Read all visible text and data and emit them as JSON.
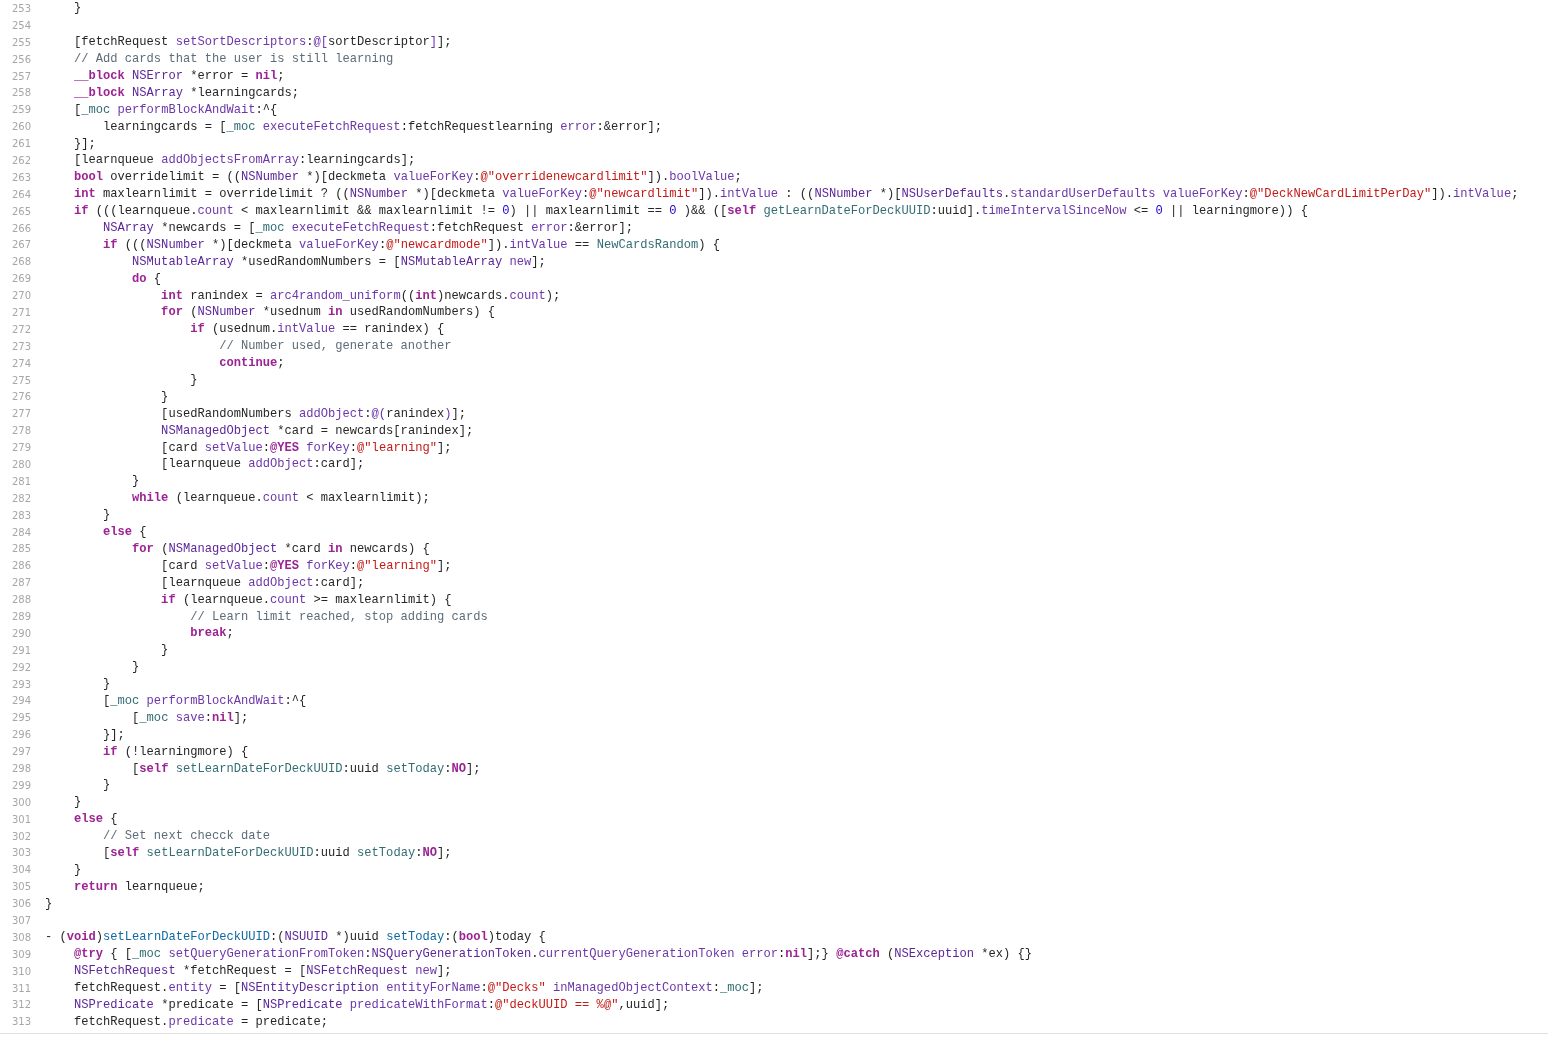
{
  "editor": {
    "lines": [
      {
        "number": "253",
        "tokens": [
          {
            "kind": "plain",
            "text": "    }"
          }
        ]
      },
      {
        "number": "254"
      },
      {
        "number": "255",
        "tokens": [
          {
            "kind": "plain",
            "text": "    [fetchRequest "
          },
          {
            "kind": "method",
            "text": "setSortDescriptors"
          },
          {
            "kind": "plain",
            "text": ":"
          },
          {
            "kind": "method",
            "text": "@["
          },
          {
            "kind": "plain",
            "text": "sortDescriptor"
          },
          {
            "kind": "method",
            "text": "]"
          },
          {
            "kind": "plain",
            "text": "];"
          }
        ]
      },
      {
        "number": "256",
        "tokens": [
          {
            "kind": "comment",
            "text": "    // Add cards that the user is still learning"
          }
        ]
      },
      {
        "number": "257",
        "tokens": [
          {
            "kind": "keyword",
            "text": "    __block"
          },
          {
            "kind": "type",
            "text": " NSError"
          },
          {
            "kind": "plain",
            "text": " *error = "
          },
          {
            "kind": "keyword",
            "text": "nil"
          },
          {
            "kind": "plain",
            "text": ";"
          }
        ]
      },
      {
        "number": "258",
        "tokens": [
          {
            "kind": "keyword",
            "text": "    __block"
          },
          {
            "kind": "type",
            "text": " NSArray"
          },
          {
            "kind": "plain",
            "text": " *learningcards;"
          }
        ]
      },
      {
        "number": "259",
        "tokens": [
          {
            "kind": "plain",
            "text": "    ["
          },
          {
            "kind": "project",
            "text": "_moc"
          },
          {
            "kind": "method",
            "text": " performBlockAndWait"
          },
          {
            "kind": "plain",
            "text": ":^{"
          }
        ]
      },
      {
        "number": "260",
        "tokens": [
          {
            "kind": "plain",
            "text": "        learningcards = ["
          },
          {
            "kind": "project",
            "text": "_moc"
          },
          {
            "kind": "method",
            "text": " executeFetchRequest"
          },
          {
            "kind": "plain",
            "text": ":fetchRequestlearning "
          },
          {
            "kind": "method",
            "text": "error"
          },
          {
            "kind": "plain",
            "text": ":&error];"
          }
        ]
      },
      {
        "number": "261",
        "tokens": [
          {
            "kind": "plain",
            "text": "    }];"
          }
        ]
      },
      {
        "number": "262",
        "tokens": [
          {
            "kind": "plain",
            "text": "    [learnqueue "
          },
          {
            "kind": "method",
            "text": "addObjectsFromArray"
          },
          {
            "kind": "plain",
            "text": ":learningcards];"
          }
        ]
      },
      {
        "number": "263",
        "tokens": [
          {
            "kind": "keyword",
            "text": "    bool"
          },
          {
            "kind": "plain",
            "text": " overridelimit = (("
          },
          {
            "kind": "type",
            "text": "NSNumber"
          },
          {
            "kind": "plain",
            "text": " *)[deckmeta "
          },
          {
            "kind": "method",
            "text": "valueForKey"
          },
          {
            "kind": "plain",
            "text": ":"
          },
          {
            "kind": "string",
            "text": "@\"overridenewcardlimit\""
          },
          {
            "kind": "plain",
            "text": "])."
          },
          {
            "kind": "method",
            "text": "boolValue"
          },
          {
            "kind": "plain",
            "text": ";"
          }
        ]
      },
      {
        "number": "264",
        "tokens": [
          {
            "kind": "keyword",
            "text": "    int"
          },
          {
            "kind": "plain",
            "text": " maxlearnlimit = overridelimit ? (("
          },
          {
            "kind": "type",
            "text": "NSNumber"
          },
          {
            "kind": "plain",
            "text": " *)[deckmeta "
          },
          {
            "kind": "method",
            "text": "valueForKey"
          },
          {
            "kind": "plain",
            "text": ":"
          },
          {
            "kind": "string",
            "text": "@\"newcardlimit\""
          },
          {
            "kind": "plain",
            "text": "])."
          },
          {
            "kind": "method",
            "text": "intValue"
          },
          {
            "kind": "plain",
            "text": " : (("
          },
          {
            "kind": "type",
            "text": "NSNumber"
          },
          {
            "kind": "plain",
            "text": " *)["
          },
          {
            "kind": "type",
            "text": "NSUserDefaults"
          },
          {
            "kind": "plain",
            "text": "."
          },
          {
            "kind": "method",
            "text": "standardUserDefaults valueForKey"
          },
          {
            "kind": "plain",
            "text": ":"
          },
          {
            "kind": "string",
            "text": "@\"DeckNewCardLimitPerDay\""
          },
          {
            "kind": "plain",
            "text": "])."
          },
          {
            "kind": "method",
            "text": "intValue"
          },
          {
            "kind": "plain",
            "text": ";"
          }
        ]
      },
      {
        "number": "265",
        "tokens": [
          {
            "kind": "keyword",
            "text": "    if"
          },
          {
            "kind": "plain",
            "text": " (((learnqueue."
          },
          {
            "kind": "method",
            "text": "count"
          },
          {
            "kind": "plain",
            "text": " < maxlearnlimit && maxlearnlimit != "
          },
          {
            "kind": "number",
            "text": "0"
          },
          {
            "kind": "plain",
            "text": ") || maxlearnlimit == "
          },
          {
            "kind": "number",
            "text": "0"
          },
          {
            "kind": "plain",
            "text": " )&& (["
          },
          {
            "kind": "keyword",
            "text": "self"
          },
          {
            "kind": "project",
            "text": " getLearnDateForDeckUUID"
          },
          {
            "kind": "plain",
            "text": ":uuid]."
          },
          {
            "kind": "method",
            "text": "timeIntervalSinceNow"
          },
          {
            "kind": "plain",
            "text": " <= "
          },
          {
            "kind": "number",
            "text": "0"
          },
          {
            "kind": "plain",
            "text": " || learningmore)) {"
          }
        ]
      },
      {
        "number": "266",
        "tokens": [
          {
            "kind": "type",
            "text": "        NSArray"
          },
          {
            "kind": "plain",
            "text": " *newcards = ["
          },
          {
            "kind": "project",
            "text": "_moc"
          },
          {
            "kind": "method",
            "text": " executeFetchRequest"
          },
          {
            "kind": "plain",
            "text": ":fetchRequest "
          },
          {
            "kind": "method",
            "text": "error"
          },
          {
            "kind": "plain",
            "text": ":&error];"
          }
        ]
      },
      {
        "number": "267",
        "tokens": [
          {
            "kind": "keyword",
            "text": "        if"
          },
          {
            "kind": "plain",
            "text": " ((("
          },
          {
            "kind": "type",
            "text": "NSNumber"
          },
          {
            "kind": "plain",
            "text": " *)[deckmeta "
          },
          {
            "kind": "method",
            "text": "valueForKey"
          },
          {
            "kind": "plain",
            "text": ":"
          },
          {
            "kind": "string",
            "text": "@\"newcardmode\""
          },
          {
            "kind": "plain",
            "text": "])."
          },
          {
            "kind": "method",
            "text": "intValue"
          },
          {
            "kind": "plain",
            "text": " == "
          },
          {
            "kind": "project",
            "text": "NewCardsRandom"
          },
          {
            "kind": "plain",
            "text": ") {"
          }
        ]
      },
      {
        "number": "268",
        "tokens": [
          {
            "kind": "type",
            "text": "            NSMutableArray"
          },
          {
            "kind": "plain",
            "text": " *usedRandomNumbers = ["
          },
          {
            "kind": "type",
            "text": "NSMutableArray"
          },
          {
            "kind": "method",
            "text": " new"
          },
          {
            "kind": "plain",
            "text": "];"
          }
        ]
      },
      {
        "number": "269",
        "tokens": [
          {
            "kind": "keyword",
            "text": "            do"
          },
          {
            "kind": "plain",
            "text": " {"
          }
        ]
      },
      {
        "number": "270",
        "tokens": [
          {
            "kind": "keyword",
            "text": "                int"
          },
          {
            "kind": "plain",
            "text": " ranindex = "
          },
          {
            "kind": "method",
            "text": "arc4random_uniform"
          },
          {
            "kind": "plain",
            "text": "(("
          },
          {
            "kind": "keyword",
            "text": "int"
          },
          {
            "kind": "plain",
            "text": ")newcards."
          },
          {
            "kind": "method",
            "text": "count"
          },
          {
            "kind": "plain",
            "text": ");"
          }
        ]
      },
      {
        "number": "271",
        "tokens": [
          {
            "kind": "keyword",
            "text": "                for"
          },
          {
            "kind": "plain",
            "text": " ("
          },
          {
            "kind": "type",
            "text": "NSNumber"
          },
          {
            "kind": "plain",
            "text": " *usednum "
          },
          {
            "kind": "keyword",
            "text": "in"
          },
          {
            "kind": "plain",
            "text": " usedRandomNumbers) {"
          }
        ]
      },
      {
        "number": "272",
        "tokens": [
          {
            "kind": "keyword",
            "text": "                    if"
          },
          {
            "kind": "plain",
            "text": " (usednum."
          },
          {
            "kind": "method",
            "text": "intValue"
          },
          {
            "kind": "plain",
            "text": " == ranindex) {"
          }
        ]
      },
      {
        "number": "273",
        "tokens": [
          {
            "kind": "comment",
            "text": "                        // Number used, generate another"
          }
        ]
      },
      {
        "number": "274",
        "tokens": [
          {
            "kind": "keyword",
            "text": "                        continue"
          },
          {
            "kind": "plain",
            "text": ";"
          }
        ]
      },
      {
        "number": "275",
        "tokens": [
          {
            "kind": "plain",
            "text": "                    }"
          }
        ]
      },
      {
        "number": "276",
        "tokens": [
          {
            "kind": "plain",
            "text": "                }"
          }
        ]
      },
      {
        "number": "277",
        "tokens": [
          {
            "kind": "plain",
            "text": "                [usedRandomNumbers "
          },
          {
            "kind": "method",
            "text": "addObject"
          },
          {
            "kind": "plain",
            "text": ":"
          },
          {
            "kind": "method",
            "text": "@("
          },
          {
            "kind": "plain",
            "text": "ranindex"
          },
          {
            "kind": "method",
            "text": ")"
          },
          {
            "kind": "plain",
            "text": "];"
          }
        ]
      },
      {
        "number": "278",
        "tokens": [
          {
            "kind": "type",
            "text": "                NSManagedObject"
          },
          {
            "kind": "plain",
            "text": " *card = newcards[ranindex];"
          }
        ]
      },
      {
        "number": "279",
        "tokens": [
          {
            "kind": "plain",
            "text": "                [card "
          },
          {
            "kind": "method",
            "text": "setValue"
          },
          {
            "kind": "plain",
            "text": ":"
          },
          {
            "kind": "keyword",
            "text": "@YES"
          },
          {
            "kind": "method",
            "text": " forKey"
          },
          {
            "kind": "plain",
            "text": ":"
          },
          {
            "kind": "string",
            "text": "@\"learning\""
          },
          {
            "kind": "plain",
            "text": "];"
          }
        ]
      },
      {
        "number": "280",
        "tokens": [
          {
            "kind": "plain",
            "text": "                [learnqueue "
          },
          {
            "kind": "method",
            "text": "addObject"
          },
          {
            "kind": "plain",
            "text": ":card];"
          }
        ]
      },
      {
        "number": "281",
        "tokens": [
          {
            "kind": "plain",
            "text": "            }"
          }
        ]
      },
      {
        "number": "282",
        "tokens": [
          {
            "kind": "keyword",
            "text": "            while"
          },
          {
            "kind": "plain",
            "text": " (learnqueue."
          },
          {
            "kind": "method",
            "text": "count"
          },
          {
            "kind": "plain",
            "text": " < maxlearnlimit);"
          }
        ]
      },
      {
        "number": "283",
        "tokens": [
          {
            "kind": "plain",
            "text": "        }"
          }
        ]
      },
      {
        "number": "284",
        "tokens": [
          {
            "kind": "keyword",
            "text": "        else"
          },
          {
            "kind": "plain",
            "text": " {"
          }
        ]
      },
      {
        "number": "285",
        "tokens": [
          {
            "kind": "keyword",
            "text": "            for"
          },
          {
            "kind": "plain",
            "text": " ("
          },
          {
            "kind": "type",
            "text": "NSManagedObject"
          },
          {
            "kind": "plain",
            "text": " *card "
          },
          {
            "kind": "keyword",
            "text": "in"
          },
          {
            "kind": "plain",
            "text": " newcards) {"
          }
        ]
      },
      {
        "number": "286",
        "tokens": [
          {
            "kind": "plain",
            "text": "                [card "
          },
          {
            "kind": "method",
            "text": "setValue"
          },
          {
            "kind": "plain",
            "text": ":"
          },
          {
            "kind": "keyword",
            "text": "@YES"
          },
          {
            "kind": "method",
            "text": " forKey"
          },
          {
            "kind": "plain",
            "text": ":"
          },
          {
            "kind": "string",
            "text": "@\"learning\""
          },
          {
            "kind": "plain",
            "text": "];"
          }
        ]
      },
      {
        "number": "287",
        "tokens": [
          {
            "kind": "plain",
            "text": "                [learnqueue "
          },
          {
            "kind": "method",
            "text": "addObject"
          },
          {
            "kind": "plain",
            "text": ":card];"
          }
        ]
      },
      {
        "number": "288",
        "tokens": [
          {
            "kind": "keyword",
            "text": "                if"
          },
          {
            "kind": "plain",
            "text": " (learnqueue."
          },
          {
            "kind": "method",
            "text": "count"
          },
          {
            "kind": "plain",
            "text": " >= maxlearnlimit) {"
          }
        ]
      },
      {
        "number": "289",
        "tokens": [
          {
            "kind": "comment",
            "text": "                    // Learn limit reached, stop adding cards"
          }
        ]
      },
      {
        "number": "290",
        "tokens": [
          {
            "kind": "keyword",
            "text": "                    break"
          },
          {
            "kind": "plain",
            "text": ";"
          }
        ]
      },
      {
        "number": "291",
        "tokens": [
          {
            "kind": "plain",
            "text": "                }"
          }
        ]
      },
      {
        "number": "292",
        "tokens": [
          {
            "kind": "plain",
            "text": "            }"
          }
        ]
      },
      {
        "number": "293",
        "tokens": [
          {
            "kind": "plain",
            "text": "        }"
          }
        ]
      },
      {
        "number": "294",
        "tokens": [
          {
            "kind": "plain",
            "text": "        ["
          },
          {
            "kind": "project",
            "text": "_moc"
          },
          {
            "kind": "method",
            "text": " performBlockAndWait"
          },
          {
            "kind": "plain",
            "text": ":^{"
          }
        ]
      },
      {
        "number": "295",
        "tokens": [
          {
            "kind": "plain",
            "text": "            ["
          },
          {
            "kind": "project",
            "text": "_moc"
          },
          {
            "kind": "method",
            "text": " save"
          },
          {
            "kind": "plain",
            "text": ":"
          },
          {
            "kind": "keyword",
            "text": "nil"
          },
          {
            "kind": "plain",
            "text": "];"
          }
        ]
      },
      {
        "number": "296",
        "tokens": [
          {
            "kind": "plain",
            "text": "        }];"
          }
        ]
      },
      {
        "number": "297",
        "tokens": [
          {
            "kind": "keyword",
            "text": "        if"
          },
          {
            "kind": "plain",
            "text": " (!learningmore) {"
          }
        ]
      },
      {
        "number": "298",
        "tokens": [
          {
            "kind": "plain",
            "text": "            ["
          },
          {
            "kind": "keyword",
            "text": "self"
          },
          {
            "kind": "project",
            "text": " setLearnDateForDeckUUID"
          },
          {
            "kind": "plain",
            "text": ":uuid "
          },
          {
            "kind": "project",
            "text": "setToday"
          },
          {
            "kind": "plain",
            "text": ":"
          },
          {
            "kind": "keyword",
            "text": "NO"
          },
          {
            "kind": "plain",
            "text": "];"
          }
        ]
      },
      {
        "number": "299",
        "tokens": [
          {
            "kind": "plain",
            "text": "        }"
          }
        ]
      },
      {
        "number": "300",
        "tokens": [
          {
            "kind": "plain",
            "text": "    }"
          }
        ]
      },
      {
        "number": "301",
        "tokens": [
          {
            "kind": "keyword",
            "text": "    else"
          },
          {
            "kind": "plain",
            "text": " {"
          }
        ]
      },
      {
        "number": "302",
        "tokens": [
          {
            "kind": "comment",
            "text": "        // Set next checck date"
          }
        ]
      },
      {
        "number": "303",
        "tokens": [
          {
            "kind": "plain",
            "text": "        ["
          },
          {
            "kind": "keyword",
            "text": "self"
          },
          {
            "kind": "project",
            "text": " setLearnDateForDeckUUID"
          },
          {
            "kind": "plain",
            "text": ":uuid "
          },
          {
            "kind": "project",
            "text": "setToday"
          },
          {
            "kind": "plain",
            "text": ":"
          },
          {
            "kind": "keyword",
            "text": "NO"
          },
          {
            "kind": "plain",
            "text": "];"
          }
        ]
      },
      {
        "number": "304",
        "tokens": [
          {
            "kind": "plain",
            "text": "    }"
          }
        ]
      },
      {
        "number": "305",
        "tokens": [
          {
            "kind": "keyword",
            "text": "    return"
          },
          {
            "kind": "plain",
            "text": " learnqueue;"
          }
        ]
      },
      {
        "number": "306",
        "tokens": [
          {
            "kind": "plain",
            "text": "}"
          }
        ]
      },
      {
        "number": "307"
      },
      {
        "number": "308",
        "tokens": [
          {
            "kind": "plain",
            "text": "- ("
          },
          {
            "kind": "keyword",
            "text": "void"
          },
          {
            "kind": "plain",
            "text": ")"
          },
          {
            "kind": "decl",
            "text": "setLearnDateForDeckUUID"
          },
          {
            "kind": "plain",
            "text": ":("
          },
          {
            "kind": "type",
            "text": "NSUUID"
          },
          {
            "kind": "plain",
            "text": " *)uuid "
          },
          {
            "kind": "decl",
            "text": "setToday"
          },
          {
            "kind": "plain",
            "text": ":("
          },
          {
            "kind": "keyword",
            "text": "bool"
          },
          {
            "kind": "plain",
            "text": ")today {"
          }
        ]
      },
      {
        "number": "309",
        "tokens": [
          {
            "kind": "keyword",
            "text": "    @try"
          },
          {
            "kind": "plain",
            "text": " { ["
          },
          {
            "kind": "project",
            "text": "_moc"
          },
          {
            "kind": "method",
            "text": " setQueryGenerationFromToken"
          },
          {
            "kind": "plain",
            "text": ":"
          },
          {
            "kind": "type",
            "text": "NSQueryGenerationToken"
          },
          {
            "kind": "plain",
            "text": "."
          },
          {
            "kind": "method",
            "text": "currentQueryGenerationToken error"
          },
          {
            "kind": "plain",
            "text": ":"
          },
          {
            "kind": "keyword",
            "text": "nil"
          },
          {
            "kind": "plain",
            "text": "];} "
          },
          {
            "kind": "keyword",
            "text": "@catch"
          },
          {
            "kind": "plain",
            "text": " ("
          },
          {
            "kind": "type",
            "text": "NSException"
          },
          {
            "kind": "plain",
            "text": " *ex) {}"
          }
        ]
      },
      {
        "number": "310",
        "tokens": [
          {
            "kind": "type",
            "text": "    NSFetchRequest"
          },
          {
            "kind": "plain",
            "text": " *fetchRequest = ["
          },
          {
            "kind": "type",
            "text": "NSFetchRequest"
          },
          {
            "kind": "method",
            "text": " new"
          },
          {
            "kind": "plain",
            "text": "];"
          }
        ]
      },
      {
        "number": "311",
        "tokens": [
          {
            "kind": "plain",
            "text": "    fetchRequest."
          },
          {
            "kind": "method",
            "text": "entity"
          },
          {
            "kind": "plain",
            "text": " = ["
          },
          {
            "kind": "type",
            "text": "NSEntityDescription"
          },
          {
            "kind": "method",
            "text": " entityForName"
          },
          {
            "kind": "plain",
            "text": ":"
          },
          {
            "kind": "string",
            "text": "@\"Decks\""
          },
          {
            "kind": "method",
            "text": " inManagedObjectContext"
          },
          {
            "kind": "plain",
            "text": ":"
          },
          {
            "kind": "project",
            "text": "_moc"
          },
          {
            "kind": "plain",
            "text": "];"
          }
        ]
      },
      {
        "number": "312",
        "tokens": [
          {
            "kind": "type",
            "text": "    NSPredicate"
          },
          {
            "kind": "plain",
            "text": " *predicate = ["
          },
          {
            "kind": "type",
            "text": "NSPredicate"
          },
          {
            "kind": "method",
            "text": " predicateWithFormat"
          },
          {
            "kind": "plain",
            "text": ":"
          },
          {
            "kind": "string",
            "text": "@\"deckUUID == %@\""
          },
          {
            "kind": "plain",
            "text": ",uuid];"
          }
        ]
      },
      {
        "number": "313",
        "tokens": [
          {
            "kind": "plain",
            "text": "    fetchRequest."
          },
          {
            "kind": "method",
            "text": "predicate"
          },
          {
            "kind": "plain",
            "text": " = predicate;"
          }
        ]
      }
    ]
  }
}
